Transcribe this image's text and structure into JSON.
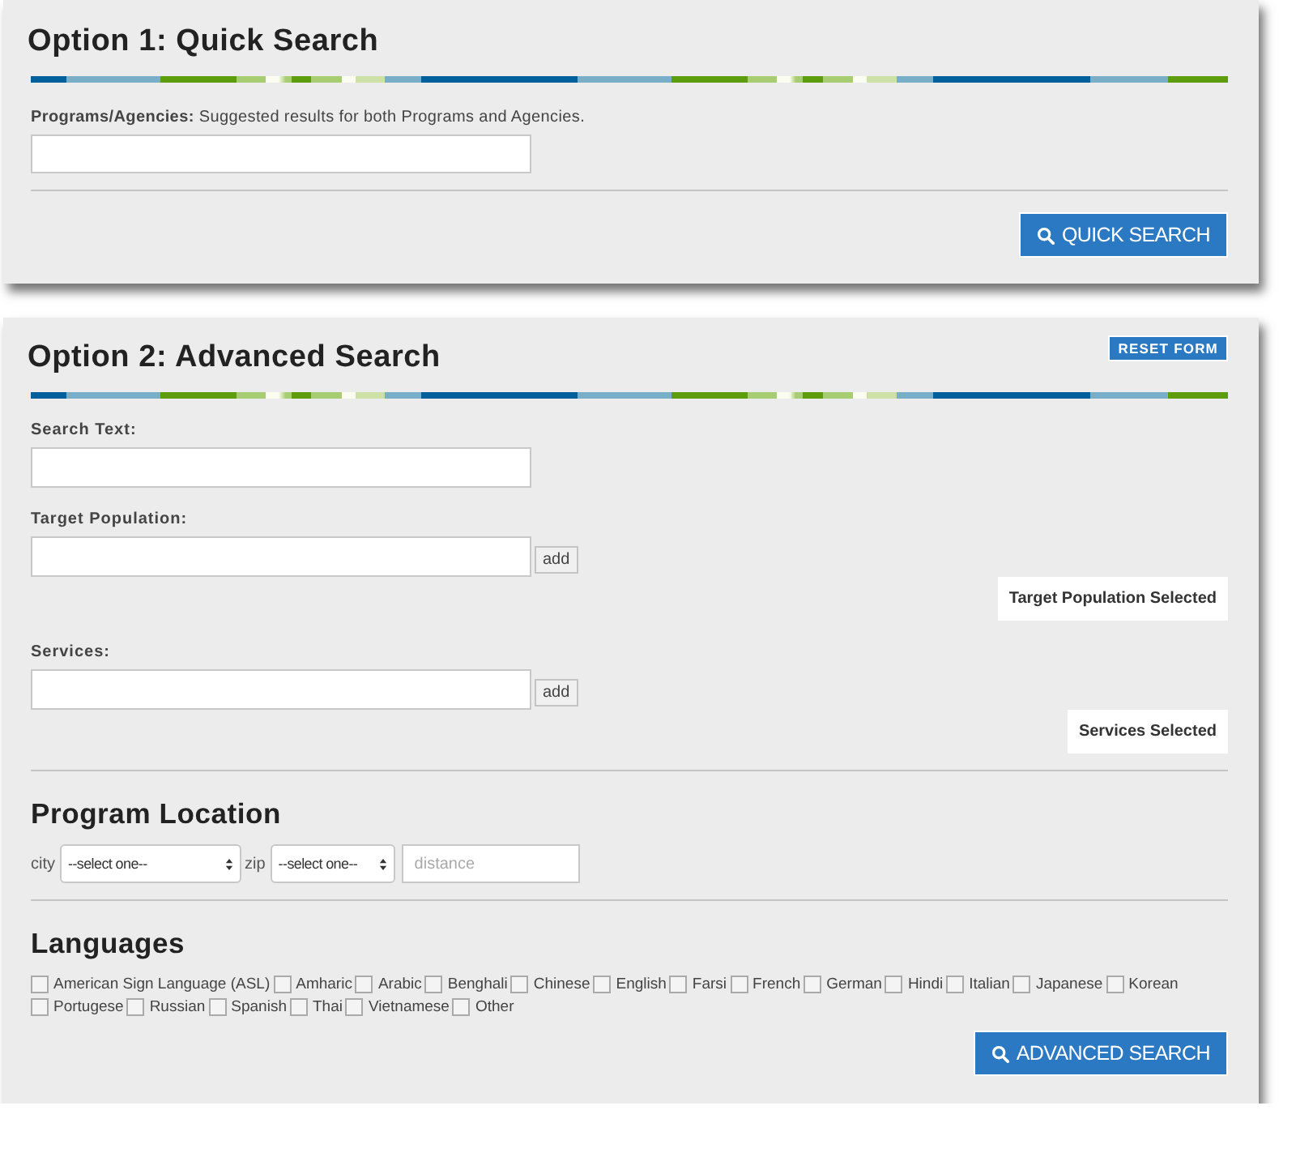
{
  "quick_search": {
    "title": "Option 1: Quick Search",
    "field_label": "Programs/Agencies:",
    "field_hint": "Suggested results for both Programs and Agencies.",
    "button": "QUICK SEARCH"
  },
  "advanced_search": {
    "title": "Option 2: Advanced Search",
    "reset_button": "RESET FORM",
    "fields": [
      {
        "label": "Search Text:"
      },
      {
        "label": "Target Population:",
        "add_button": "add",
        "selected_box": "Target Population Selected"
      },
      {
        "label": "Services:",
        "add_button": "add",
        "selected_box": "Services Selected"
      }
    ],
    "location": {
      "heading": "Program Location",
      "city_label": "city",
      "city_select": "--select one--",
      "zip_label": "zip",
      "zip_select": "--select one--",
      "distance_placeholder": "distance"
    },
    "languages": {
      "heading": "Languages",
      "options": [
        {
          "label": "American Sign Language (ASL)",
          "checked": false
        },
        {
          "label": "Amharic",
          "checked": false
        },
        {
          "label": "Arabic",
          "checked": false
        },
        {
          "label": "Benghali",
          "checked": false
        },
        {
          "label": "Chinese",
          "checked": false
        },
        {
          "label": "English",
          "checked": false
        },
        {
          "label": "Farsi",
          "checked": false
        },
        {
          "label": "French",
          "checked": false
        },
        {
          "label": "German",
          "checked": false
        },
        {
          "label": "Hindi",
          "checked": false
        },
        {
          "label": "Italian",
          "checked": false
        },
        {
          "label": "Japanese",
          "checked": false
        },
        {
          "label": "Korean",
          "checked": false
        },
        {
          "label": "Portugese",
          "checked": false
        },
        {
          "label": "Russian",
          "checked": false
        },
        {
          "label": "Spanish",
          "checked": false
        },
        {
          "label": "Thai",
          "checked": false
        },
        {
          "label": "Vietnamese",
          "checked": false
        },
        {
          "label": "Other",
          "checked": false
        }
      ]
    },
    "button": "ADVANCED SEARCH"
  }
}
